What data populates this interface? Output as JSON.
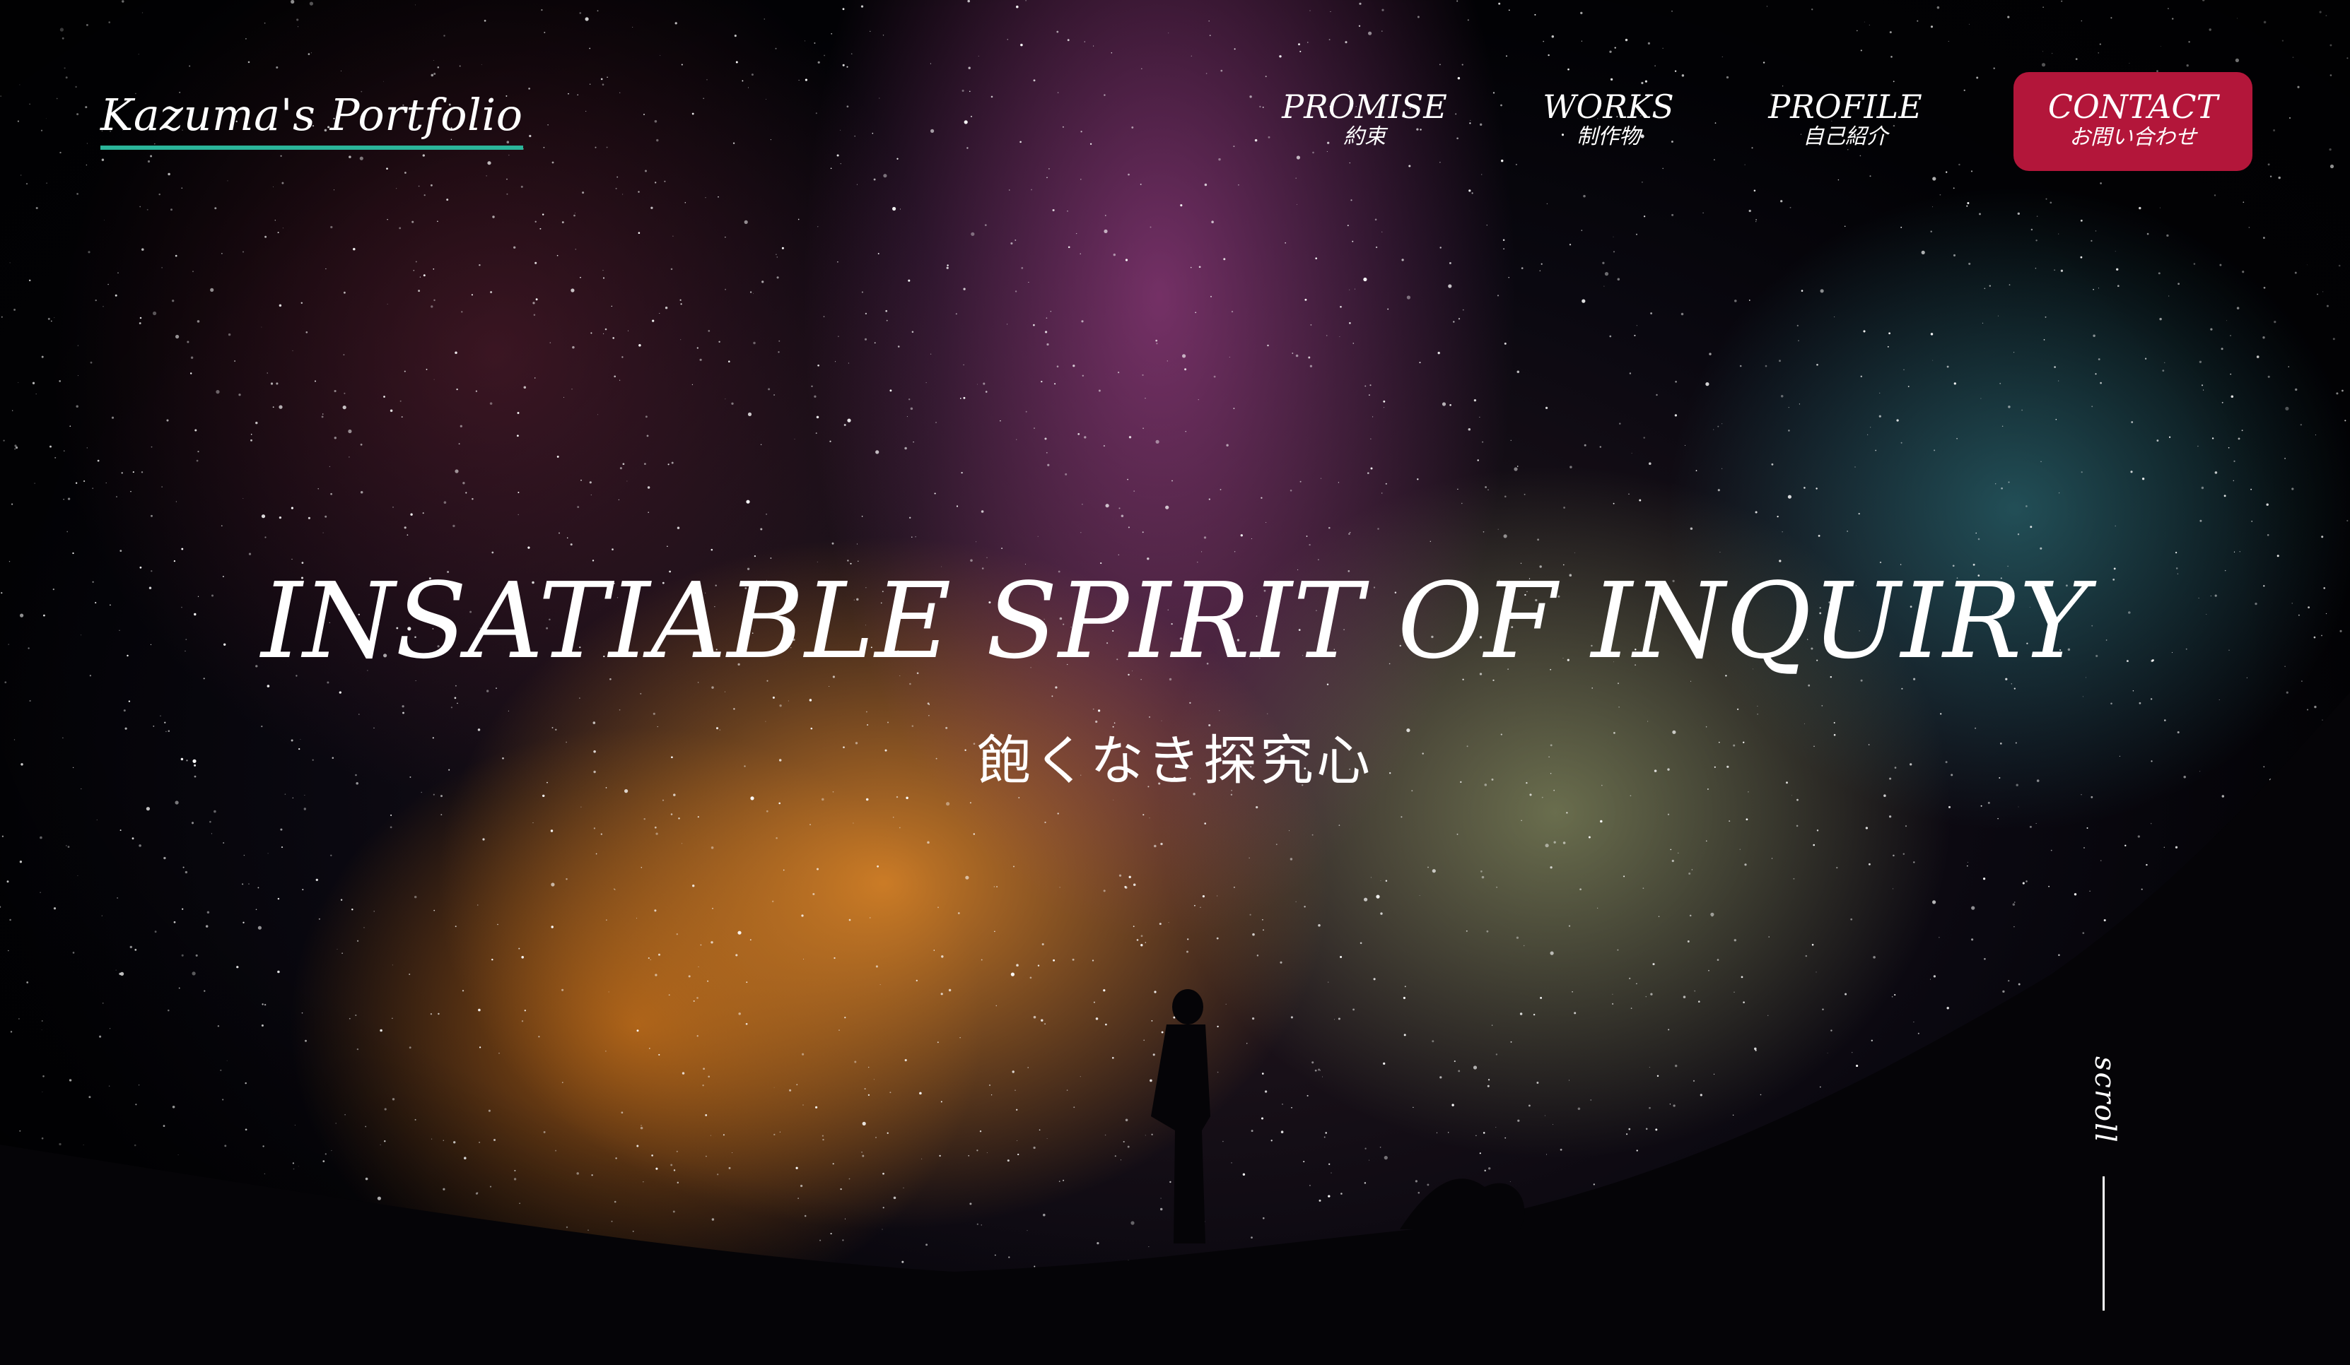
{
  "header": {
    "logo": "Kazuma's Portfolio",
    "nav": [
      {
        "en": "PROMISE",
        "ja": "約束"
      },
      {
        "en": "WORKS",
        "ja": "制作物"
      },
      {
        "en": "PROFILE",
        "ja": "自己紹介"
      }
    ],
    "contact": {
      "en": "CONTACT",
      "ja": "お問い合わせ"
    }
  },
  "hero": {
    "headline": "INSATIABLE SPIRIT OF INQUIRY",
    "subline": "飽くなき探究心",
    "scroll_label": "scroll"
  },
  "colors": {
    "accent_underline": "#2bb59a",
    "contact_button": "#b3163a",
    "text": "#ffffff"
  }
}
